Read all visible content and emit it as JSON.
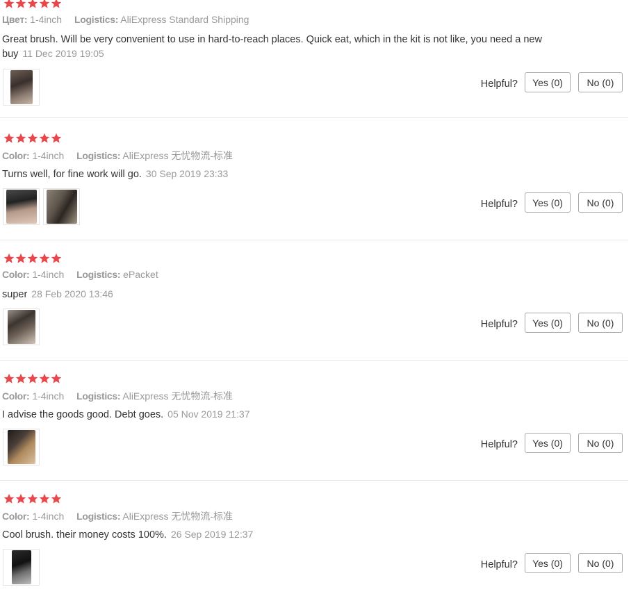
{
  "colors": {
    "star": "#e8474c",
    "muted_text": "#999999",
    "body_text": "#333333",
    "divider": "#e6e6e6",
    "button_border": "#a8a8a8"
  },
  "reviews": [
    {
      "stars": 5,
      "color_key": "Цвет:",
      "color_value": "1-4inch",
      "logistics_key": "Logistics:",
      "logistics_value": "AliExpress Standard Shipping",
      "text": "Great brush. Will be very convenient to use in hard-to-reach places. Quick eat, which in the kit is not like, you need a new buy",
      "date": "11 Dec 2019 19:05",
      "photos": [
        {
          "tone": "dark-brush-photo"
        }
      ],
      "helpful_label": "Helpful?",
      "yes_label": "Yes (0)",
      "no_label": "No (0)"
    },
    {
      "stars": 5,
      "color_key": "Color:",
      "color_value": "1-4inch",
      "logistics_key": "Logistics:",
      "logistics_value": "AliExpress 无忧物流-标准",
      "text": "Turns well, for fine work will go.",
      "date": "30 Sep 2019 23:33",
      "photos": [
        {
          "tone": "hand-brush-photo"
        },
        {
          "tone": "brush-on-table-photo"
        }
      ],
      "helpful_label": "Helpful?",
      "yes_label": "Yes (0)",
      "no_label": "No (0)"
    },
    {
      "stars": 5,
      "color_key": "Color:",
      "color_value": "1-4inch",
      "logistics_key": "Logistics:",
      "logistics_value": "ePacket",
      "text": "super",
      "date": "28 Feb 2020 13:46",
      "photos": [
        {
          "tone": "brush-in-hand-photo"
        }
      ],
      "helpful_label": "Helpful?",
      "yes_label": "Yes (0)",
      "no_label": "No (0)"
    },
    {
      "stars": 5,
      "color_key": "Color:",
      "color_value": "1-4inch",
      "logistics_key": "Logistics:",
      "logistics_value": "AliExpress 无忧物流-标准",
      "text": "I advise the goods good. Debt goes.",
      "date": "05 Nov 2019 21:37",
      "photos": [
        {
          "tone": "brush-closeup-photo"
        }
      ],
      "helpful_label": "Helpful?",
      "yes_label": "Yes (0)",
      "no_label": "No (0)"
    },
    {
      "stars": 5,
      "color_key": "Color:",
      "color_value": "1-4inch",
      "logistics_key": "Logistics:",
      "logistics_value": "AliExpress 无忧物流-标准",
      "text": "Cool brush. their money costs 100%.",
      "date": "26 Sep 2019 12:37",
      "photos": [
        {
          "tone": "brush-dark-photo"
        }
      ],
      "helpful_label": "Helpful?",
      "yes_label": "Yes (0)",
      "no_label": "No (0)"
    }
  ]
}
